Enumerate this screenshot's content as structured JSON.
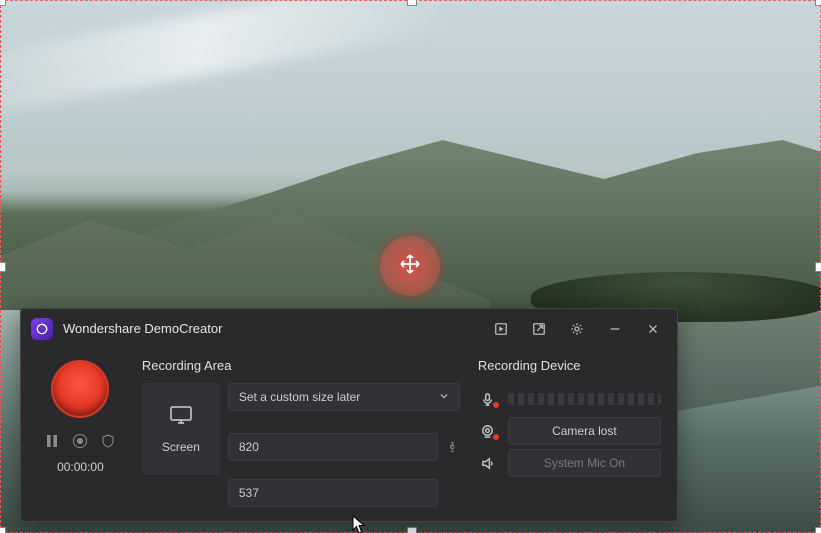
{
  "app": {
    "title": "Wondershare DemoCreator"
  },
  "record": {
    "timer": "00:00:00"
  },
  "area": {
    "title": "Recording Area",
    "screenLabel": "Screen",
    "presetLabel": "Set a custom size later",
    "width": "820",
    "height": "537"
  },
  "device": {
    "title": "Recording Device",
    "cameraLabel": "Camera lost",
    "micLabel": "System Mic On"
  }
}
